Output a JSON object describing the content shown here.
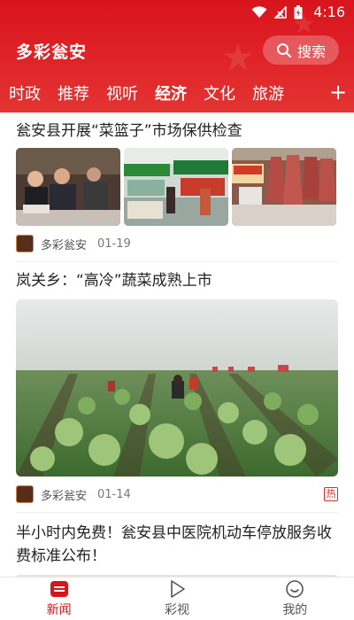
{
  "status": {
    "time": "4:16"
  },
  "header": {
    "title": "多彩瓮安",
    "search_label": "搜索"
  },
  "tabs": [
    "时政",
    "推荐",
    "视听",
    "经济",
    "文化",
    "旅游"
  ],
  "active_tab": "经济",
  "feed": [
    {
      "title": "瓮安县开展“菜篮子”市场保供检查",
      "source": "多彩瓮安",
      "date": "01-19"
    },
    {
      "title": "岚关乡：“高冷”蔬菜成熟上市",
      "source": "多彩瓮安",
      "date": "01-14",
      "badge": "热"
    },
    {
      "title": "半小时内免费！瓮安县中医院机动车停放服务收费标准公布！"
    }
  ],
  "bottom_nav": {
    "news": "新闻",
    "video": "彩视",
    "mine": "我的"
  },
  "colors": {
    "brand": "#d8141c"
  }
}
